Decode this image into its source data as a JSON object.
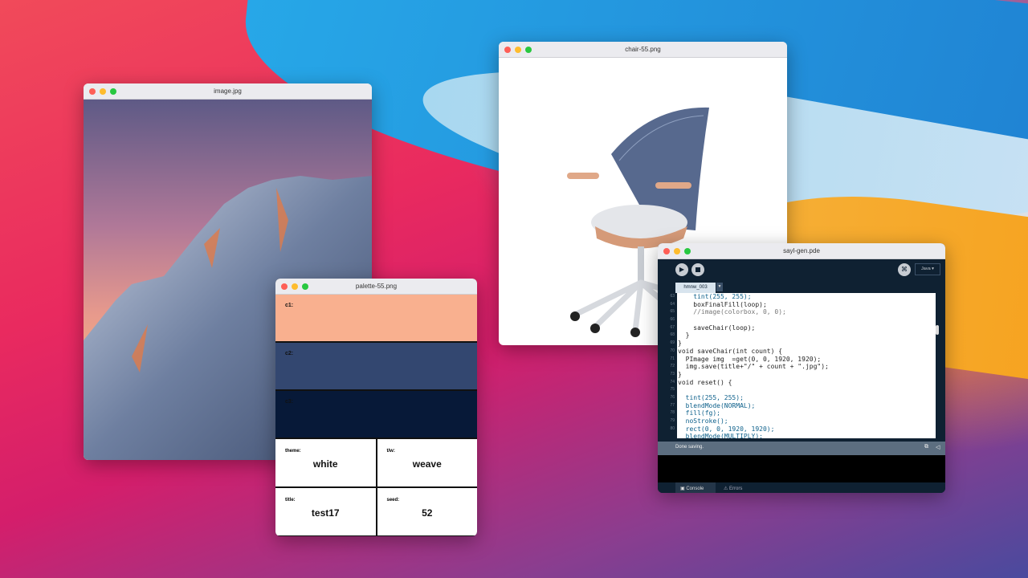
{
  "windows": {
    "image": {
      "title": "image.jpg"
    },
    "chair": {
      "title": "chair-55.png"
    },
    "palette": {
      "title": "palette-55.png",
      "swatches": [
        {
          "label": "c1:",
          "color": "#f9b08f"
        },
        {
          "label": "c2:",
          "color": "#334770"
        },
        {
          "label": "c3:",
          "color": "#071938"
        }
      ],
      "fields": [
        {
          "key": "theme:",
          "value": "white"
        },
        {
          "key": "t/w:",
          "value": "weave"
        },
        {
          "key": "title:",
          "value": "test17"
        },
        {
          "key": "seed:",
          "value": "52"
        }
      ]
    },
    "editor": {
      "title": "sayl-gen.pde",
      "mode": "Java ▾",
      "tab": "hmnw_003",
      "line_numbers": [
        "63",
        "64",
        "65",
        "66",
        "67",
        "68",
        "69",
        "70",
        "71",
        "72",
        "73",
        "74",
        "75",
        "76",
        "77",
        "78",
        "79",
        "80"
      ],
      "lines": [
        "    tint(255, 255);",
        "    boxFinalFill(loop);",
        "    //image(colorbox, 0, 0);",
        "",
        "    saveChair(loop);",
        "  }",
        "}",
        "void saveChair(int count) {",
        "  PImage img  =get(0, 0, 1920, 1920);",
        "  img.save(title+\"/\" + count + \".jpg\");",
        "}",
        "void reset() {",
        "",
        "  tint(255, 255);",
        "  blendMode(NORMAL);",
        "  fill(fg);",
        "  noStroke();",
        "  rect(0, 0, 1920, 1920);",
        "  blendMode(MULTIPLY);"
      ],
      "status": "Done saving.",
      "console_tab": "Console",
      "errors_tab": "Errors"
    }
  }
}
